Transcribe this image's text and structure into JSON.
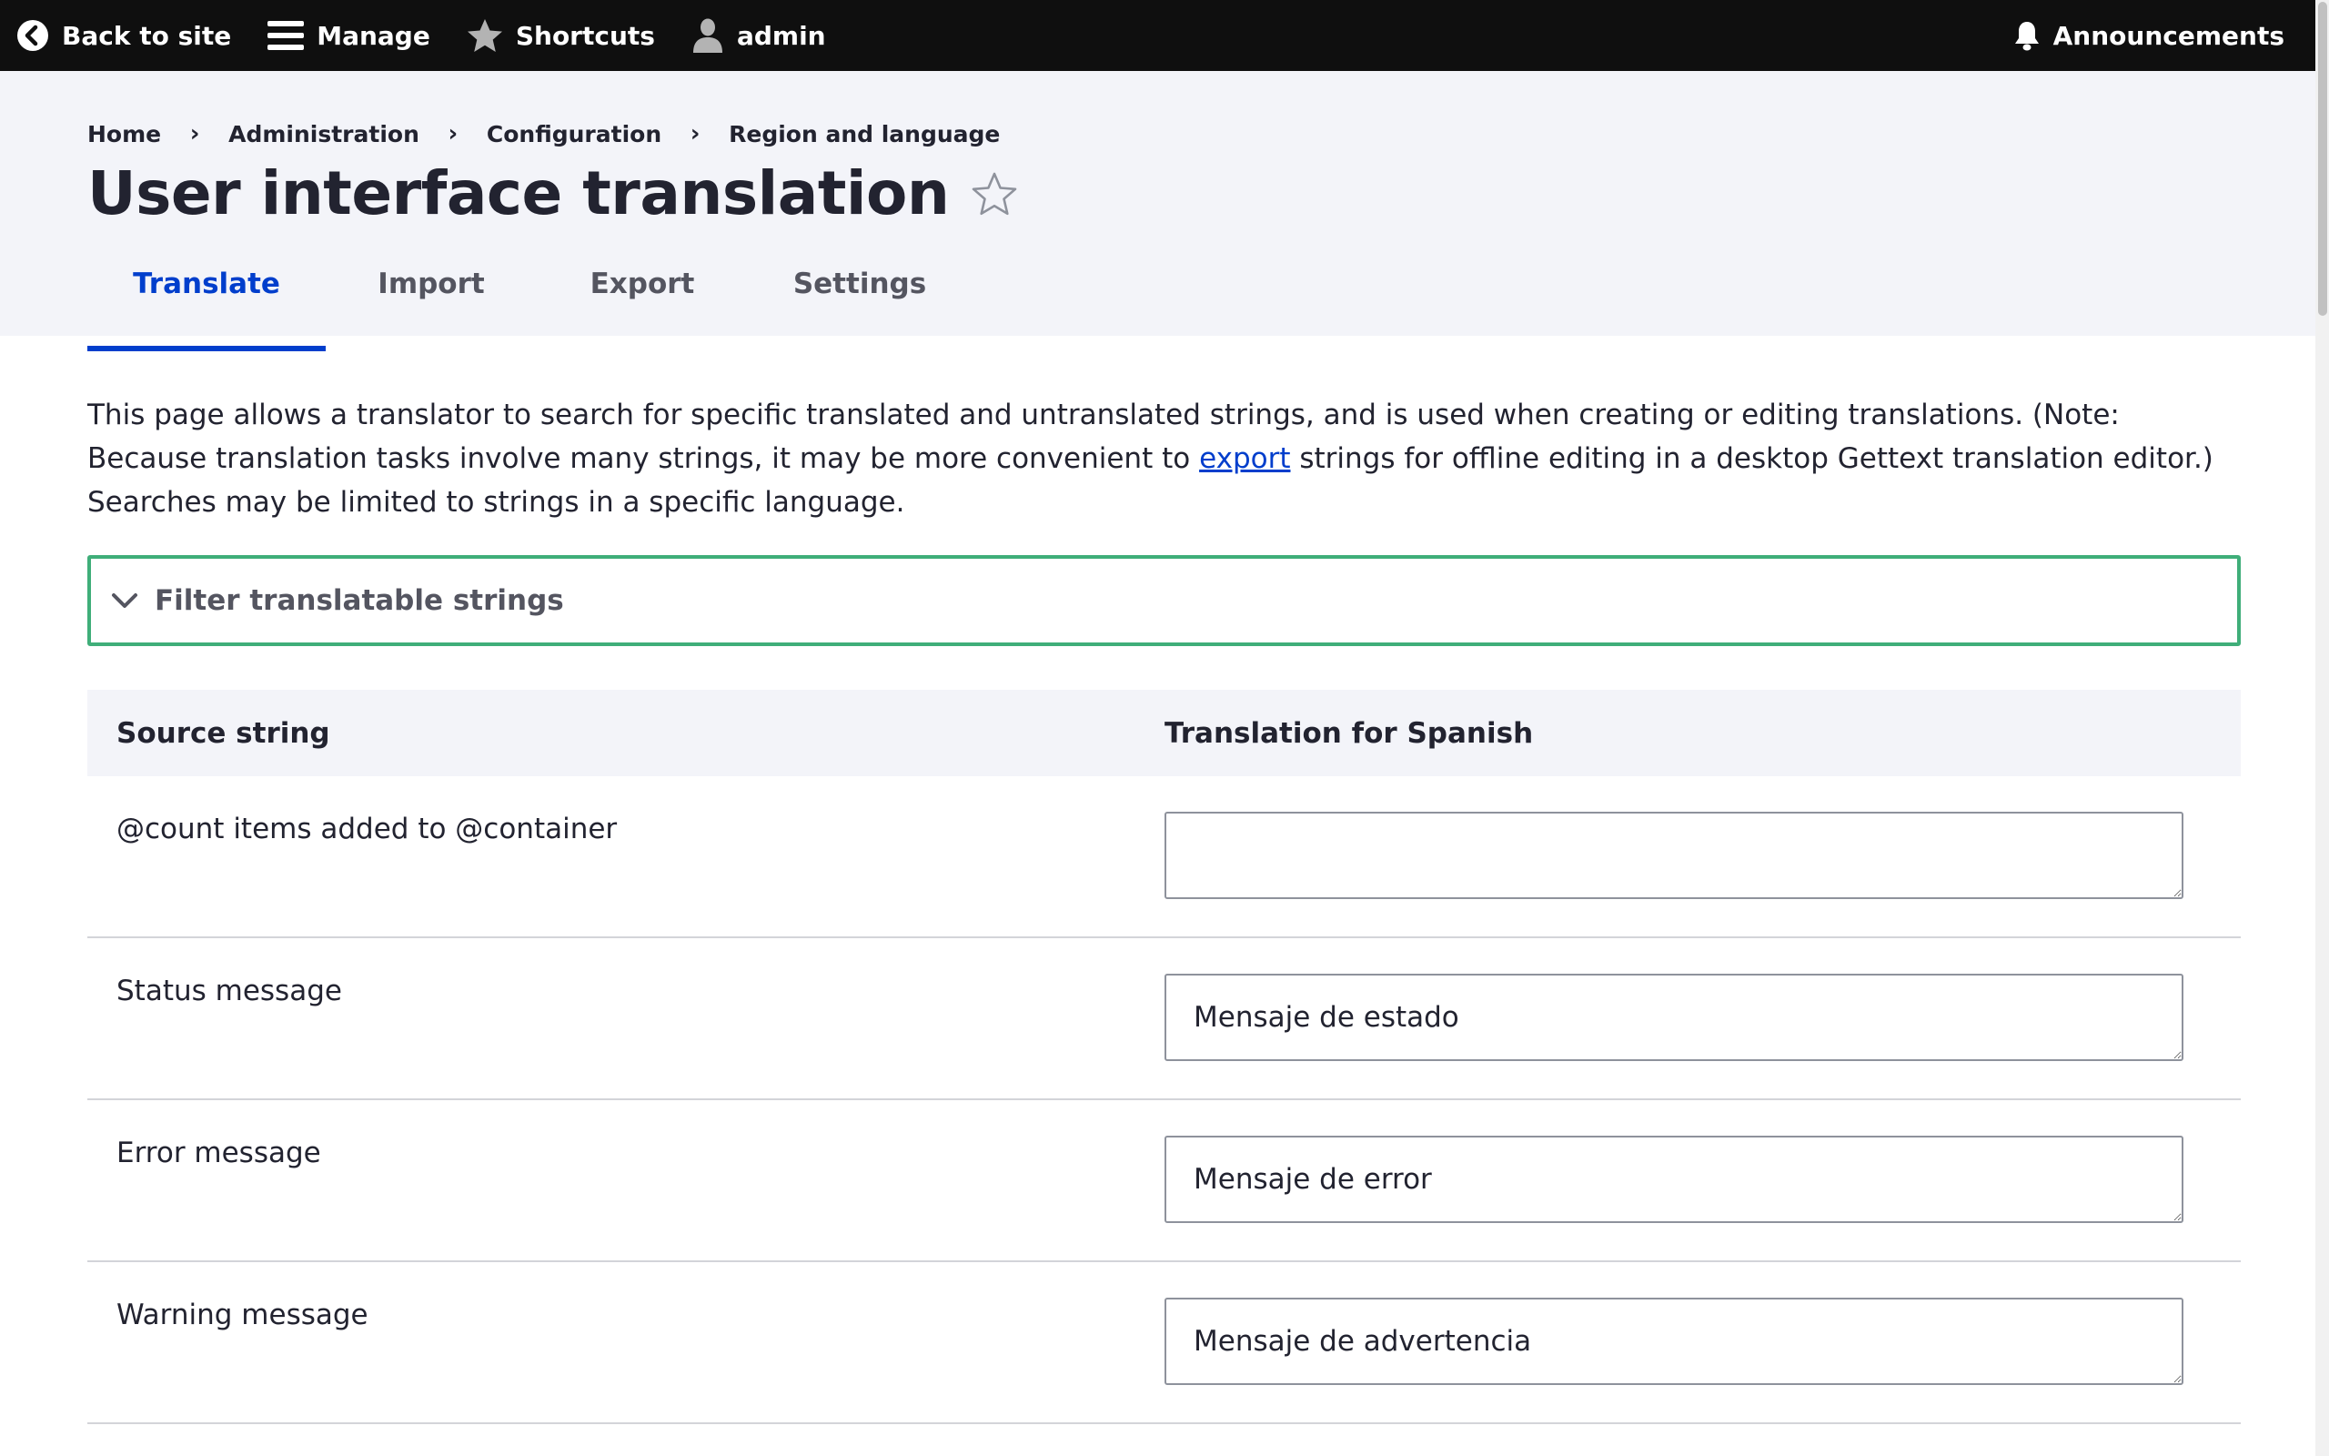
{
  "toolbar": {
    "back_label": "Back to site",
    "manage_label": "Manage",
    "shortcuts_label": "Shortcuts",
    "user_label": "admin",
    "announcements_label": "Announcements"
  },
  "breadcrumb": {
    "items": [
      "Home",
      "Administration",
      "Configuration",
      "Region and language"
    ],
    "separator": "›"
  },
  "page": {
    "title": "User interface translation"
  },
  "tabs": [
    {
      "label": "Translate",
      "active": true
    },
    {
      "label": "Import",
      "active": false
    },
    {
      "label": "Export",
      "active": false
    },
    {
      "label": "Settings",
      "active": false
    }
  ],
  "description": {
    "before_link": "This page allows a translator to search for specific translated and untranslated strings, and is used when creating or editing translations. (Note: Because translation tasks involve many strings, it may be more convenient to ",
    "link_text": "export",
    "after_link": " strings for offline editing in a desktop Gettext translation editor.) Searches may be limited to strings in a spe­cific language."
  },
  "filter": {
    "label": "Filter translatable strings"
  },
  "table": {
    "headers": {
      "source": "Source string",
      "translation": "Translation for Spanish"
    },
    "rows": [
      {
        "source": "@count items added to @container",
        "translation": ""
      },
      {
        "source": "Status message",
        "translation": "Mensaje de estado"
      },
      {
        "source": "Error message",
        "translation": "Mensaje de error"
      },
      {
        "source": "Warning message",
        "translation": "Mensaje de advertencia"
      }
    ]
  },
  "colors": {
    "toolbar_bg": "#0f0f0f",
    "header_bg": "#f3f4f9",
    "accent": "#003ecc",
    "focus_border": "#3fae79"
  }
}
